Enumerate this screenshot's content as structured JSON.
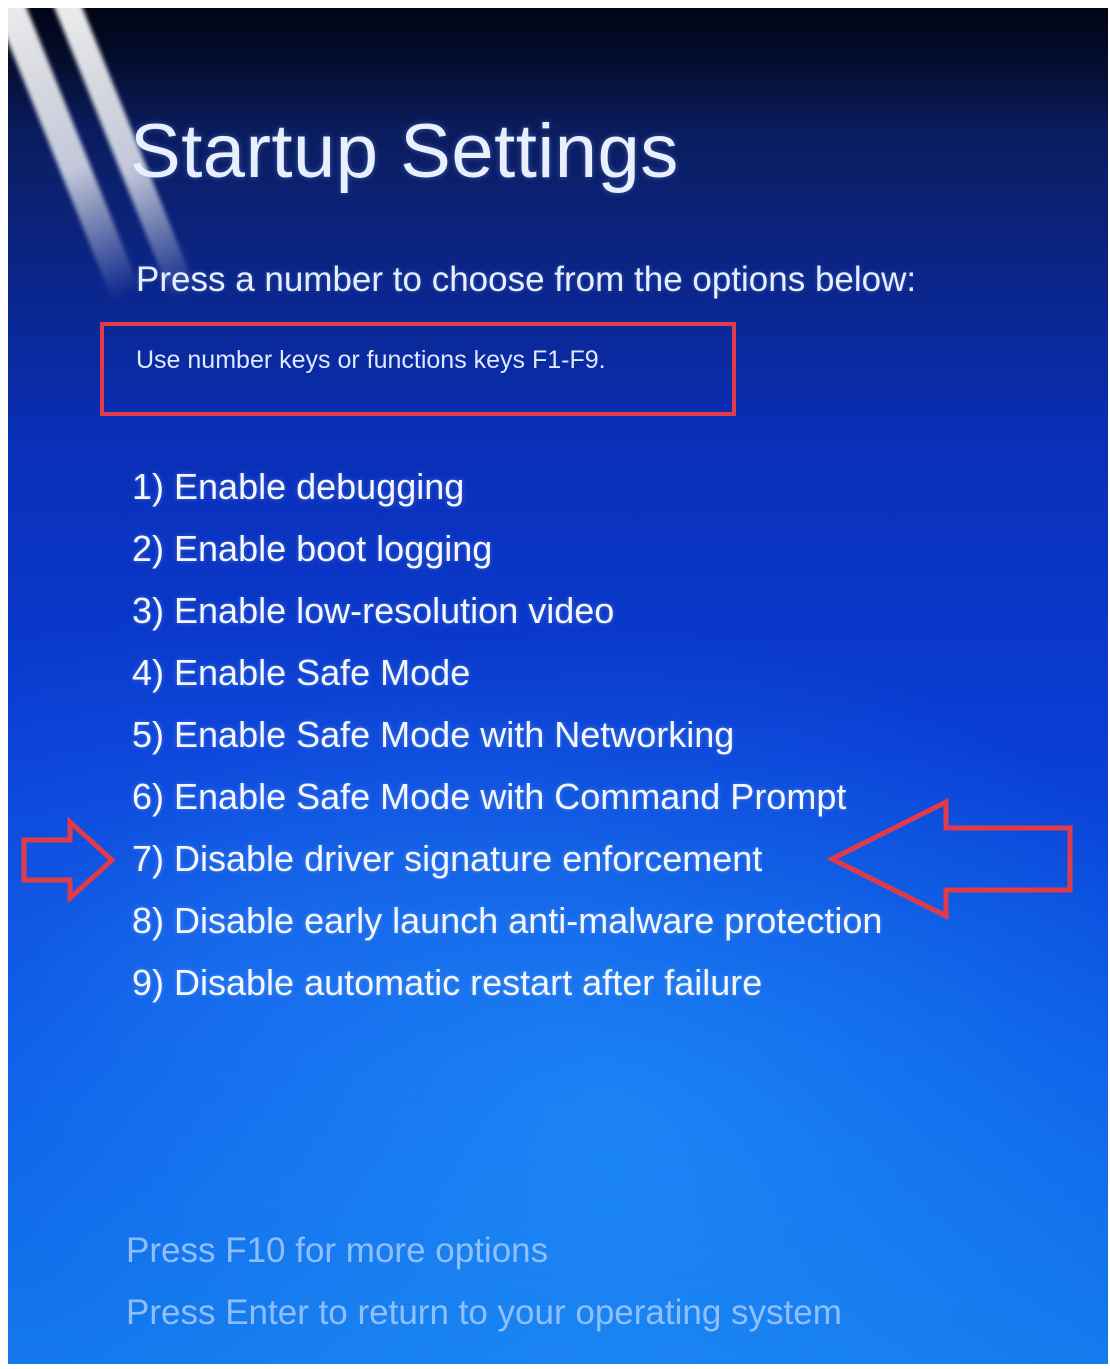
{
  "screen": {
    "title": "Startup Settings",
    "subtitle": "Press a number to choose from the options below:",
    "hint": "Use number keys or functions keys F1-F9.",
    "options": [
      {
        "label": "1) Enable debugging"
      },
      {
        "label": "2) Enable boot logging"
      },
      {
        "label": "3) Enable low-resolution video"
      },
      {
        "label": "4) Enable Safe Mode"
      },
      {
        "label": "5) Enable Safe Mode with Networking"
      },
      {
        "label": "6) Enable Safe Mode with Command Prompt"
      },
      {
        "label": "7) Disable driver signature enforcement"
      },
      {
        "label": "8) Disable early launch anti-malware protection"
      },
      {
        "label": "9) Disable automatic restart after failure"
      }
    ],
    "footer": {
      "more_options": "Press F10 for more options",
      "return": "Press Enter to return to your operating system"
    }
  },
  "annotations": {
    "highlight_color": "#e23a48",
    "highlighted_option": "7) Disable driver signature enforcement",
    "left_arrow_icon": "arrow-right-outline-icon",
    "right_arrow_icon": "arrow-left-outline-icon"
  }
}
